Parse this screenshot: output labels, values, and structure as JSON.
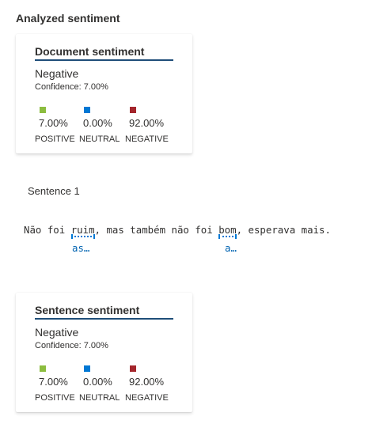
{
  "page": {
    "heading": "Analyzed sentiment"
  },
  "document_sentiment": {
    "title": "Document sentiment",
    "label": "Negative",
    "confidence_text": "Confidence: 7.00%",
    "scores": [
      {
        "name": "POSITIVE",
        "value": "7.00%",
        "color": "#8cbd3f"
      },
      {
        "name": "NEUTRAL",
        "value": "0.00%",
        "color": "#0078d4"
      },
      {
        "name": "NEGATIVE",
        "value": "92.00%",
        "color": "#a4262c"
      }
    ]
  },
  "sentence": {
    "heading": "Sentence 1",
    "segments": [
      "Não foi ",
      "ruim",
      ", mas também não foi ",
      "bom",
      ", esperava mais."
    ],
    "assessments": [
      "as…",
      "a…"
    ]
  },
  "sentence_sentiment": {
    "title": "Sentence sentiment",
    "label": "Negative",
    "confidence_text": "Confidence: 7.00%",
    "scores": [
      {
        "name": "POSITIVE",
        "value": "7.00%",
        "color": "#8cbd3f"
      },
      {
        "name": "NEUTRAL",
        "value": "0.00%",
        "color": "#0078d4"
      },
      {
        "name": "NEGATIVE",
        "value": "92.00%",
        "color": "#a4262c"
      }
    ]
  }
}
